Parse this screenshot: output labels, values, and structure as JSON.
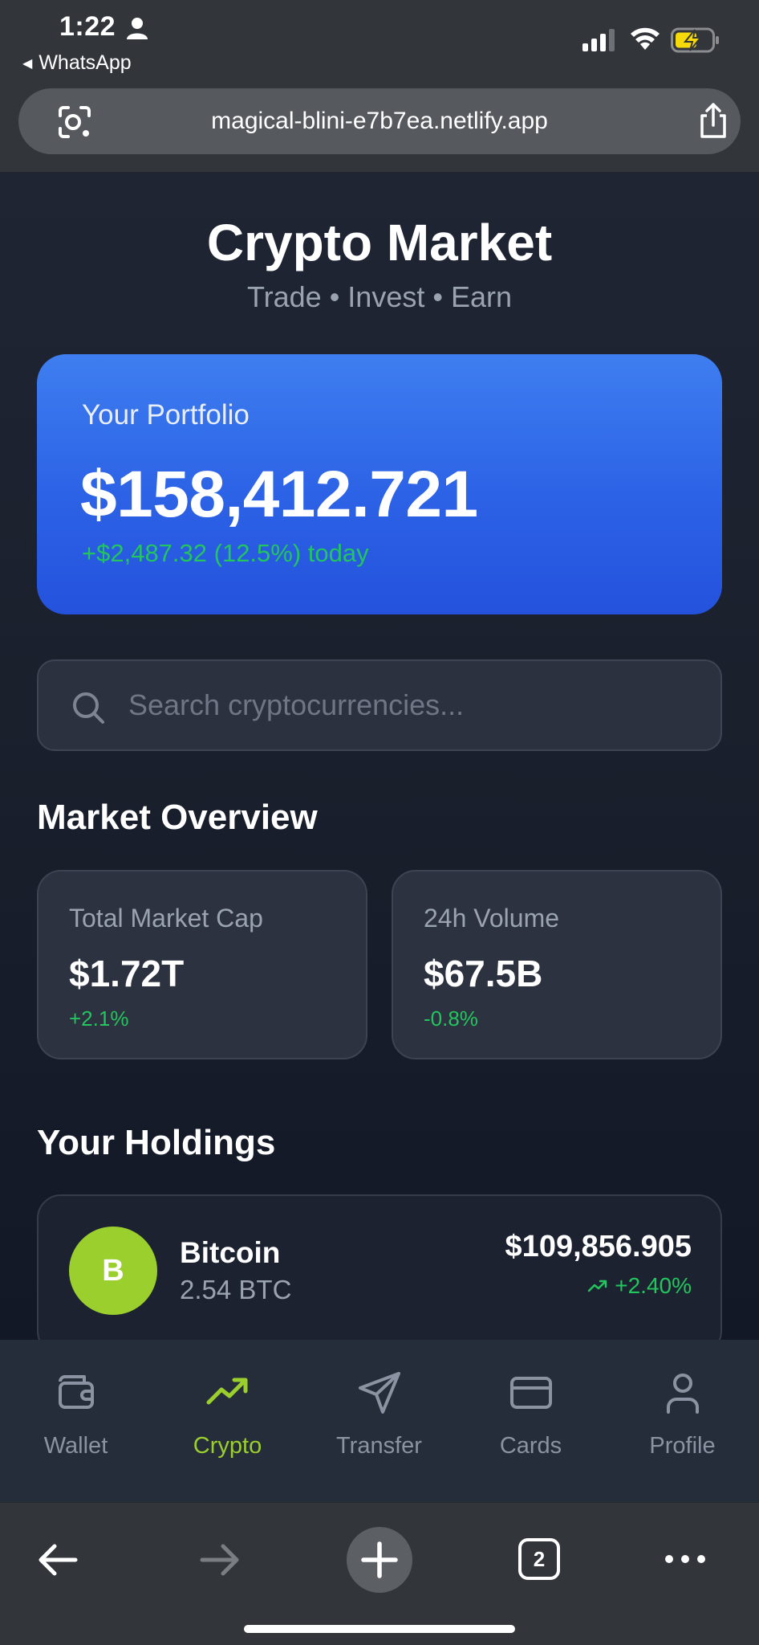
{
  "status_bar": {
    "time": "1:22",
    "back_app": "WhatsApp"
  },
  "browser": {
    "url": "magical-blini-e7b7ea.netlify.app",
    "tab_count": "2"
  },
  "header": {
    "title": "Crypto Market",
    "subtitle": "Trade • Invest • Earn"
  },
  "portfolio": {
    "label": "Your Portfolio",
    "value": "$158,412.721",
    "change": "+$2,487.32 (12.5%) today"
  },
  "search": {
    "placeholder": "Search cryptocurrencies..."
  },
  "market_overview": {
    "title": "Market Overview",
    "cards": [
      {
        "label": "Total Market Cap",
        "value": "$1.72T",
        "change": "+2.1%"
      },
      {
        "label": "24h Volume",
        "value": "$67.5B",
        "change": "-0.8%"
      }
    ]
  },
  "holdings": {
    "title": "Your Holdings",
    "items": [
      {
        "initial": "B",
        "name": "Bitcoin",
        "amount": "2.54 BTC",
        "value": "$109,856.905",
        "change": "+2.40%"
      }
    ]
  },
  "nav": {
    "items": [
      {
        "label": "Wallet",
        "icon": "wallet-icon"
      },
      {
        "label": "Crypto",
        "icon": "trending-up-icon",
        "active": true
      },
      {
        "label": "Transfer",
        "icon": "send-icon"
      },
      {
        "label": "Cards",
        "icon": "credit-card-icon"
      },
      {
        "label": "Profile",
        "icon": "user-icon"
      }
    ]
  },
  "colors": {
    "accent_green": "#9bcf2d",
    "positive": "#22c55e",
    "portfolio_blue": "#2c62e6",
    "background": "#151b27"
  }
}
